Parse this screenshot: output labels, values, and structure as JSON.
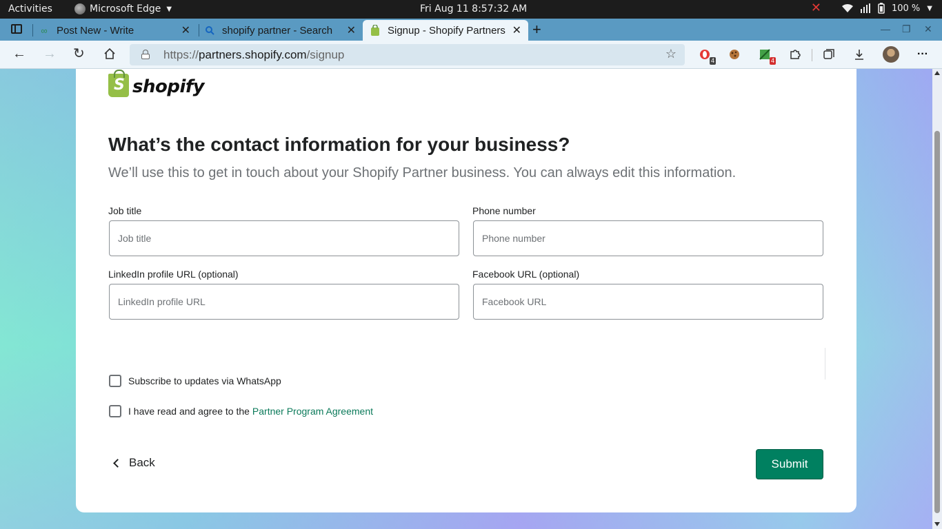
{
  "system_bar": {
    "activities": "Activities",
    "app_name": "Microsoft Edge",
    "clock": "Fri Aug 11   8:57:32 AM",
    "battery": "100 %"
  },
  "browser": {
    "tabs": [
      {
        "title": "Post New - Write",
        "icon": "infinity-icon",
        "active": false
      },
      {
        "title": "shopify partner - Search",
        "icon": "search-icon",
        "active": false
      },
      {
        "title": "Signup - Shopify Partners",
        "icon": "shopify-bag-icon",
        "active": true
      }
    ],
    "url_prefix": "https://",
    "url_host": "partners.shopify.com",
    "url_path": "/signup",
    "extension_badges": {
      "opera": "4",
      "green": "4"
    }
  },
  "page": {
    "logo_text": "shopify",
    "heading": "What’s the contact information for your business?",
    "subtext": "We’ll use this to get in touch about your Shopify Partner business. You can always edit this information.",
    "fields": {
      "job_title": {
        "label": "Job title",
        "placeholder": "Job title",
        "value": ""
      },
      "phone": {
        "label": "Phone number",
        "placeholder": "Phone number",
        "value": ""
      },
      "linkedin": {
        "label": "LinkedIn profile URL (optional)",
        "placeholder": "LinkedIn profile URL",
        "value": ""
      },
      "facebook": {
        "label": "Facebook URL (optional)",
        "placeholder": "Facebook URL",
        "value": ""
      }
    },
    "checkboxes": {
      "whatsapp": {
        "label": "Subscribe to updates via WhatsApp",
        "checked": false
      },
      "agreement": {
        "label": "I have read and agree to the",
        "link": "Partner Program Agreement",
        "checked": false
      }
    },
    "back_label": "Back",
    "submit_label": "Submit",
    "colors": {
      "primary": "#008060",
      "link": "#0b7a5a",
      "heading": "#202223",
      "subtext": "#6d7175"
    }
  }
}
